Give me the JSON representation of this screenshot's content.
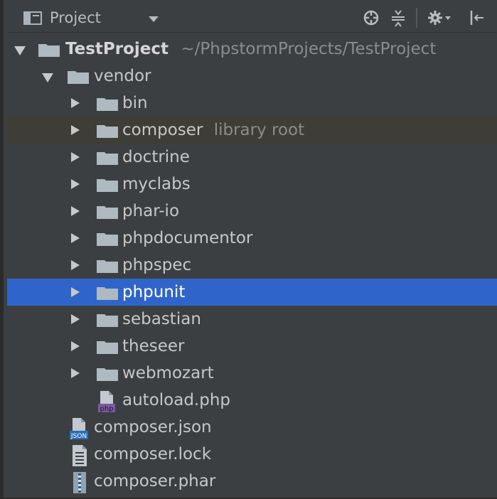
{
  "header": {
    "title": "Project"
  },
  "tree": {
    "root": {
      "label": "TestProject",
      "path": "~/PhpstormProjects/TestProject"
    },
    "vendor": {
      "label": "vendor"
    },
    "items": [
      {
        "label": "bin"
      },
      {
        "label": "composer",
        "hint": "library root"
      },
      {
        "label": "doctrine"
      },
      {
        "label": "myclabs"
      },
      {
        "label": "phar-io"
      },
      {
        "label": "phpdocumentor"
      },
      {
        "label": "phpspec"
      },
      {
        "label": "phpunit"
      },
      {
        "label": "sebastian"
      },
      {
        "label": "theseer"
      },
      {
        "label": "webmozart"
      }
    ],
    "files": [
      {
        "label": "autoload.php",
        "badge": "php"
      },
      {
        "label": "composer.json",
        "badge": "JSON"
      },
      {
        "label": "composer.lock"
      },
      {
        "label": "composer.phar"
      }
    ]
  },
  "colors": {
    "background": "#3c3f41",
    "selection": "#2f65ca",
    "library_root_row": "#3e3d36",
    "folder": "#aeb9c0"
  }
}
